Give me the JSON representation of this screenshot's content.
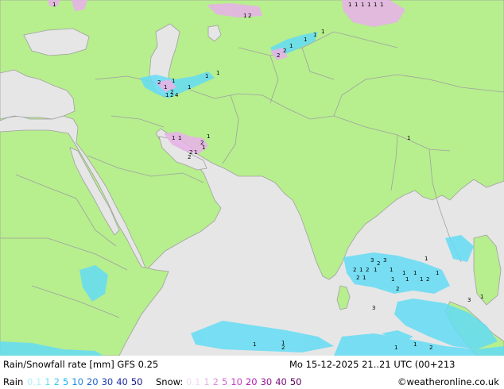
{
  "title": "Rain/Snowfall rate [mm] GFS 0.25",
  "datetime": "Mo 15-12-2025 21..21 UTC (00+213",
  "copyright": "©weatheronline.co.uk",
  "legend": {
    "rain_label": "Rain",
    "snow_label": "Snow:",
    "rain_values": [
      "0.1",
      "1",
      "2",
      "5",
      "10",
      "20",
      "30",
      "40",
      "50"
    ],
    "snow_values": [
      "0.1",
      "1",
      "2",
      "5",
      "10",
      "20",
      "30",
      "40",
      "50"
    ],
    "rain_colors": [
      "#b4f0fa",
      "#64dcf5",
      "#3cc8f0",
      "#14b4f0",
      "#1e8cdc",
      "#1e64c8",
      "#1e3cb4",
      "#1e28a0",
      "#14148c"
    ],
    "snow_colors": [
      "#f0dcf0",
      "#e6b4e6",
      "#dc8cdc",
      "#d264d2",
      "#c83cc8",
      "#b41eb4",
      "#961496",
      "#780a78",
      "#5a005a"
    ]
  },
  "colors": {
    "land": "#b7ee8e",
    "sea": "#e6e6e6",
    "border": "#a0a0a0",
    "rain": "#64dcf5",
    "snow": "#e6b4e6"
  },
  "map_numbers": {
    "caspian": [
      "2",
      "1",
      "2",
      "1",
      "1",
      "1",
      "2",
      "4",
      "1",
      "1"
    ],
    "central_asia": [
      "2",
      "2",
      "1",
      "1",
      "1",
      "1"
    ],
    "iran_gulf": [
      "1",
      "1",
      "2",
      "1",
      "2",
      "1",
      "2",
      "1",
      "1"
    ],
    "north": [
      "1",
      "1",
      "1",
      "1",
      "1",
      "1",
      "1",
      "1",
      "2"
    ],
    "bay_of_bengal": [
      "3",
      "2",
      "3",
      "2",
      "1",
      "2",
      "1",
      "1",
      "1",
      "1",
      "2",
      "1",
      "1",
      "1",
      "1",
      "2",
      "3",
      "1",
      "1",
      "2"
    ],
    "south": [
      "1",
      "2",
      "1",
      "1",
      "1",
      "2",
      "3",
      "1"
    ]
  }
}
